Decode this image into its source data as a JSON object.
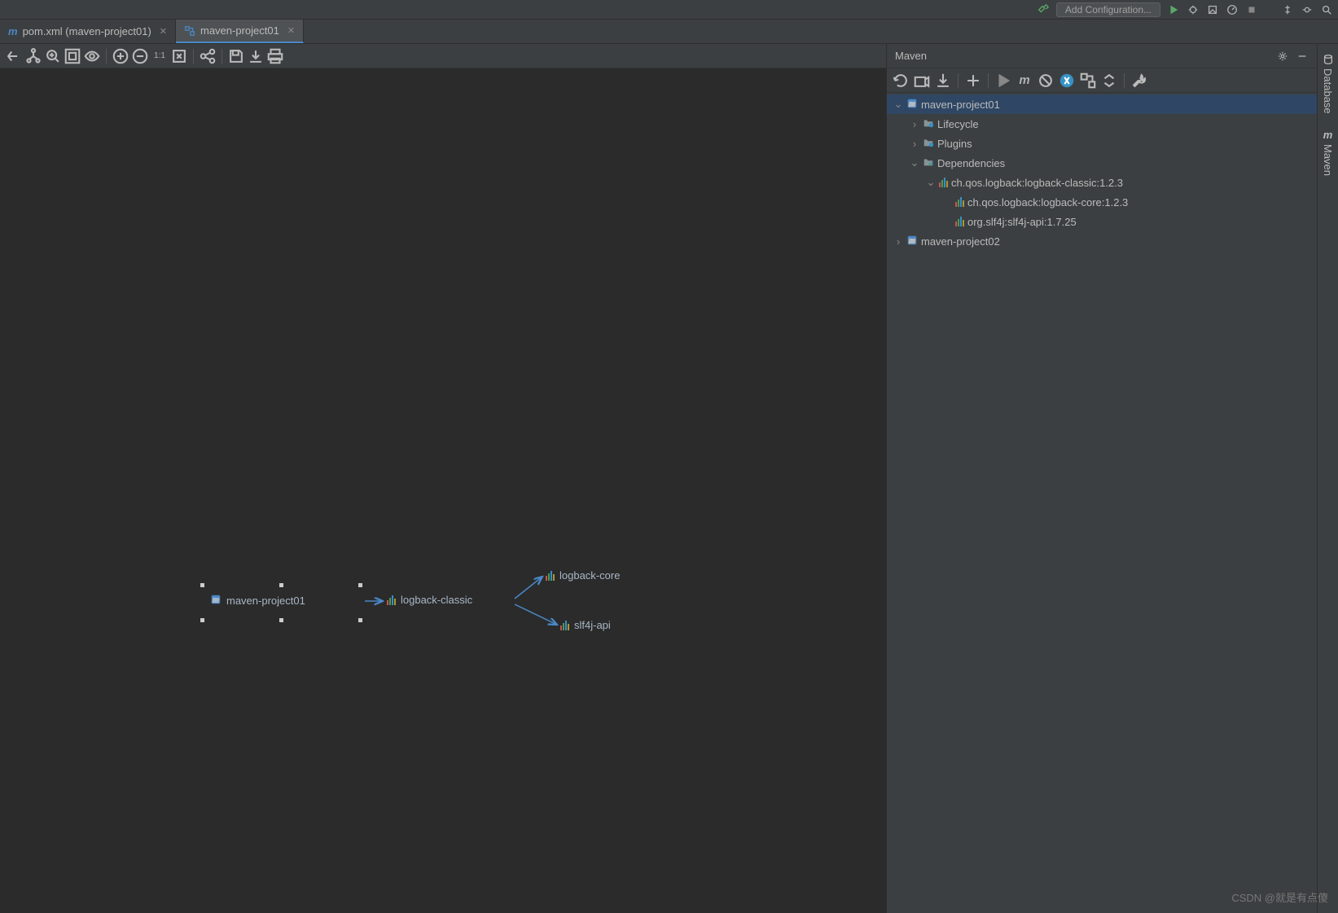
{
  "top": {
    "config_btn": "Add Configuration..."
  },
  "tabs": [
    {
      "label": "pom.xml (maven-project01)",
      "active": false,
      "icon": "m"
    },
    {
      "label": "maven-project01",
      "active": true,
      "icon": "diagram"
    }
  ],
  "diagram": {
    "nodes": {
      "root": {
        "label": "maven-project01"
      },
      "classic": {
        "label": "logback-classic"
      },
      "core": {
        "label": "logback-core"
      },
      "slf4j": {
        "label": "slf4j-api"
      }
    }
  },
  "maven": {
    "title": "Maven",
    "tree": {
      "proj1": {
        "label": "maven-project01"
      },
      "lifecycle": {
        "label": "Lifecycle"
      },
      "plugins": {
        "label": "Plugins"
      },
      "deps": {
        "label": "Dependencies"
      },
      "dep1": {
        "label": "ch.qos.logback:logback-classic:1.2.3"
      },
      "dep2": {
        "label": "ch.qos.logback:logback-core:1.2.3"
      },
      "dep3": {
        "label": "org.slf4j:slf4j-api:1.7.25"
      },
      "proj2": {
        "label": "maven-project02"
      }
    }
  },
  "rail": {
    "database": "Database",
    "maven": "Maven"
  },
  "watermark": "CSDN @就是有点傻"
}
